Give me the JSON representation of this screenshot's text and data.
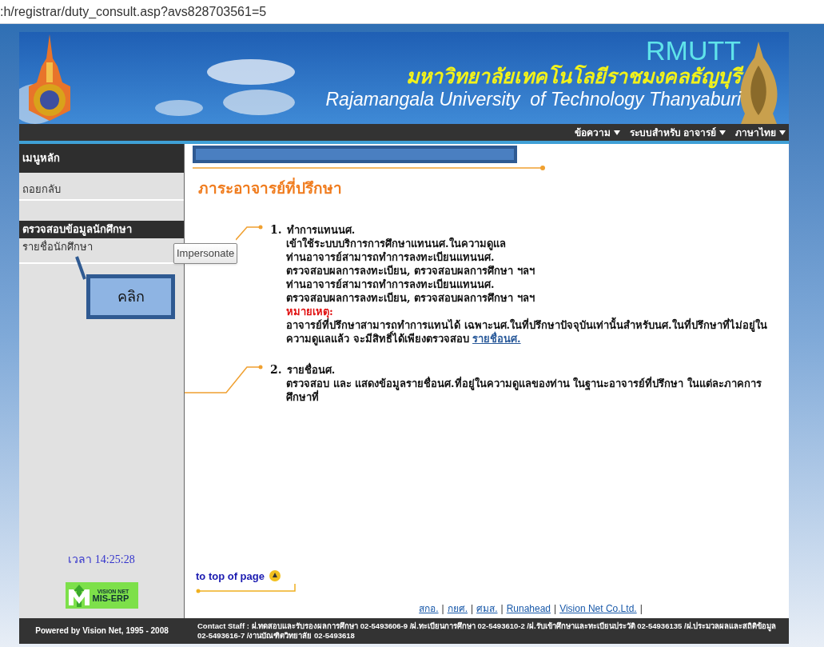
{
  "address_bar": {
    "url": ":h/registrar/duty_consult.asp?avs828703561=5"
  },
  "header": {
    "abbr": "RMUTT",
    "thai_name": "มหาวิทยาลัยเทคโนโลยีราชมงคลธัญบุรี",
    "english_name": "Rajamangala University  of Technology Thanyaburi"
  },
  "nav": [
    {
      "label": "ข้อความ"
    },
    {
      "label": "ระบบสำหรับ อาจารย์"
    },
    {
      "label": "ภาษาไทย"
    }
  ],
  "sidebar": {
    "title": "เมนูหลัก",
    "items": [
      {
        "label": "ถอยกลับ",
        "selected": false
      },
      {
        "label": "ตรวจสอบข้อมูลนักศึกษา",
        "selected": true
      },
      {
        "label": "รายชื่อนักศึกษา",
        "selected": false
      }
    ],
    "clock": "เวลา 14:25:28",
    "badge": [
      "VISION NET",
      "MIS-ERP"
    ]
  },
  "tooltip": "Impersonate",
  "callout": "คลิก",
  "content": {
    "title": "ภาระอาจารย์ที่ปรึกษา",
    "sections": [
      {
        "number": "1.",
        "heading": "ทำการแทนนศ.",
        "lines": [
          "เข้าใช้ระบบบริการการศึกษาแทนนศ.ในความดูแล",
          "ท่านอาจารย์สามารถทำการลงทะเบียนแทนนศ.",
          "ตรวจสอบผลการลงทะเบียน, ตรวจสอบผลการศึกษา ฯลฯ",
          "ท่านอาจารย์สามารถทำการลงทะเบียนแทนนศ.",
          "ตรวจสอบผลการลงทะเบียน, ตรวจสอบผลการศึกษา ฯลฯ"
        ],
        "note_label": "หมายเหตุ:",
        "note": "อาจารย์ที่ปรึกษาสามารถทำการแทนได้ เฉพาะนศ.ในที่ปรึกษาปัจจุบันเท่านั้นสำหรับนศ.ในที่ปรึกษาที่ไม่อยู่ในความดูแลแล้ว จะมีสิทธิ์ได้เพียงตรวจสอบ",
        "note_link": "รายชื่อนศ."
      },
      {
        "number": "2.",
        "heading": "รายชื่อนศ.",
        "lines": [
          "ตรวจสอบ และ แสดงข้อมูลรายชื่อนศ.ที่อยู่ในความดูแลของท่าน ในฐานะอาจารย์ที่ปรึกษา ในแต่ละภาคการศึกษาที่"
        ]
      }
    ],
    "top_link": "to top of page",
    "links": [
      "สกอ.",
      "กยศ.",
      "ศมส.",
      "Runahead",
      "Vision Net Co.Ltd."
    ],
    "link_separator": "|"
  },
  "footer": {
    "powered": "Powered by Vision Net, 1995 - 2008",
    "contact": "Contact Staff : ฝ.ทดสอบและรับรองผลการศึกษา 02-5493606-9 /ฝ.ทะเบียนการศึกษา 02-5493610-2 /ฝ.รับเข้าศึกษาและทะเบียนประวัติ 02-54936135 /ฝ.ประมวลผลและสถิติข้อมูล 02-5493616-7 /งานบัณฑิตวิทยาลัย 02-5493618"
  }
}
